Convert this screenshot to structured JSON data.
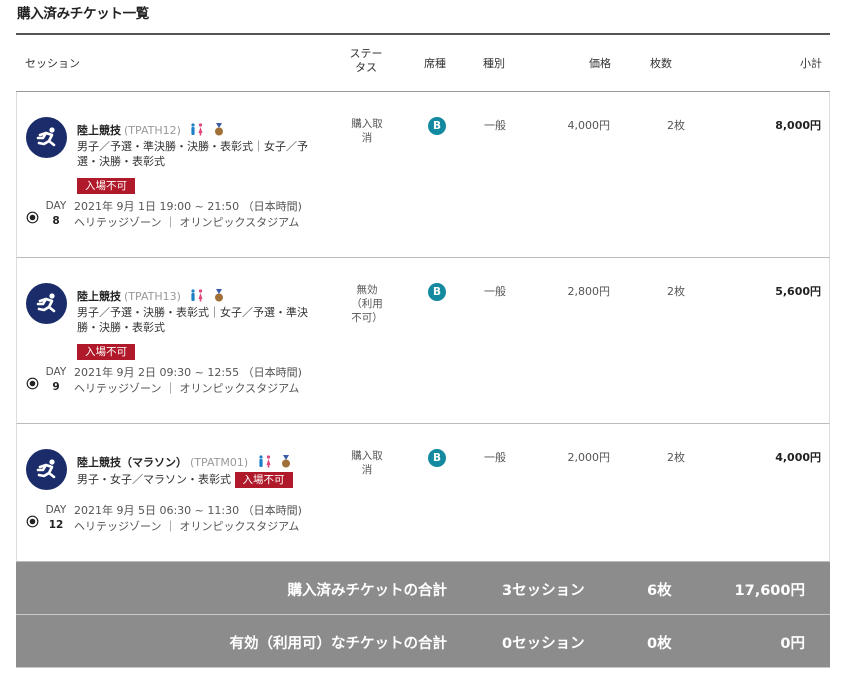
{
  "page_title": "購入済みチケット一覧",
  "columns": {
    "session": "セッション",
    "status": "ステータス",
    "seat": "席種",
    "type": "種別",
    "price": "価格",
    "quantity": "枚数",
    "subtotal": "小計"
  },
  "tickets": [
    {
      "sport": "陸上競技",
      "code": "(TPATH12)",
      "detail": "男子／予選・準決勝・決勝・表彰式｜女子／予選・決勝・表彰式",
      "entry_badge": "入場不可",
      "day_label": "DAY",
      "day_num": "8",
      "datetime": "2021年 9月 1日 19:00 ~ 21:50 （日本時間)",
      "venue": "ヘリテッジゾーン ｜ オリンピックスタジアム",
      "status": "購入取消",
      "seat": "B",
      "type": "一般",
      "price": "4,000円",
      "quantity": "2枚",
      "subtotal": "8,000円"
    },
    {
      "sport": "陸上競技",
      "code": "(TPATH13)",
      "detail": "男子／予選・決勝・表彰式｜女子／予選・準決勝・決勝・表彰式",
      "entry_badge": "入場不可",
      "day_label": "DAY",
      "day_num": "9",
      "datetime": "2021年 9月 2日 09:30 ~ 12:55 （日本時間)",
      "venue": "ヘリテッジゾーン ｜ オリンピックスタジアム",
      "status": "無効（利用不可）",
      "seat": "B",
      "type": "一般",
      "price": "2,800円",
      "quantity": "2枚",
      "subtotal": "5,600円"
    },
    {
      "sport": "陸上競技（マラソン）",
      "code": "(TPATM01)",
      "detail": "男子・女子／マラソン・表彰式",
      "entry_badge": "入場不可",
      "day_label": "DAY",
      "day_num": "12",
      "datetime": "2021年 9月 5日 06:30 ~ 11:30 （日本時間)",
      "venue": "ヘリテッジゾーン ｜ オリンピックスタジアム",
      "status": "購入取消",
      "seat": "B",
      "type": "一般",
      "price": "2,000円",
      "quantity": "2枚",
      "subtotal": "4,000円"
    }
  ],
  "summary": [
    {
      "label": "購入済みチケットの合計",
      "sessions": "3セッション",
      "count": "6枚",
      "total": "17,600円"
    },
    {
      "label": "有効（利用可）なチケットの合計",
      "sessions": "0セッション",
      "count": "0枚",
      "total": "0円"
    }
  ],
  "colors": {
    "sport_icon_bg": "#1b2c6a",
    "seat_badge": "#138aa0",
    "entry_badge": "#b0192a",
    "summary_bg": "#8c8c8c"
  },
  "icons": [
    "athletics-runner-icon",
    "men-women-icon",
    "medal-icon",
    "location-pin-icon"
  ]
}
